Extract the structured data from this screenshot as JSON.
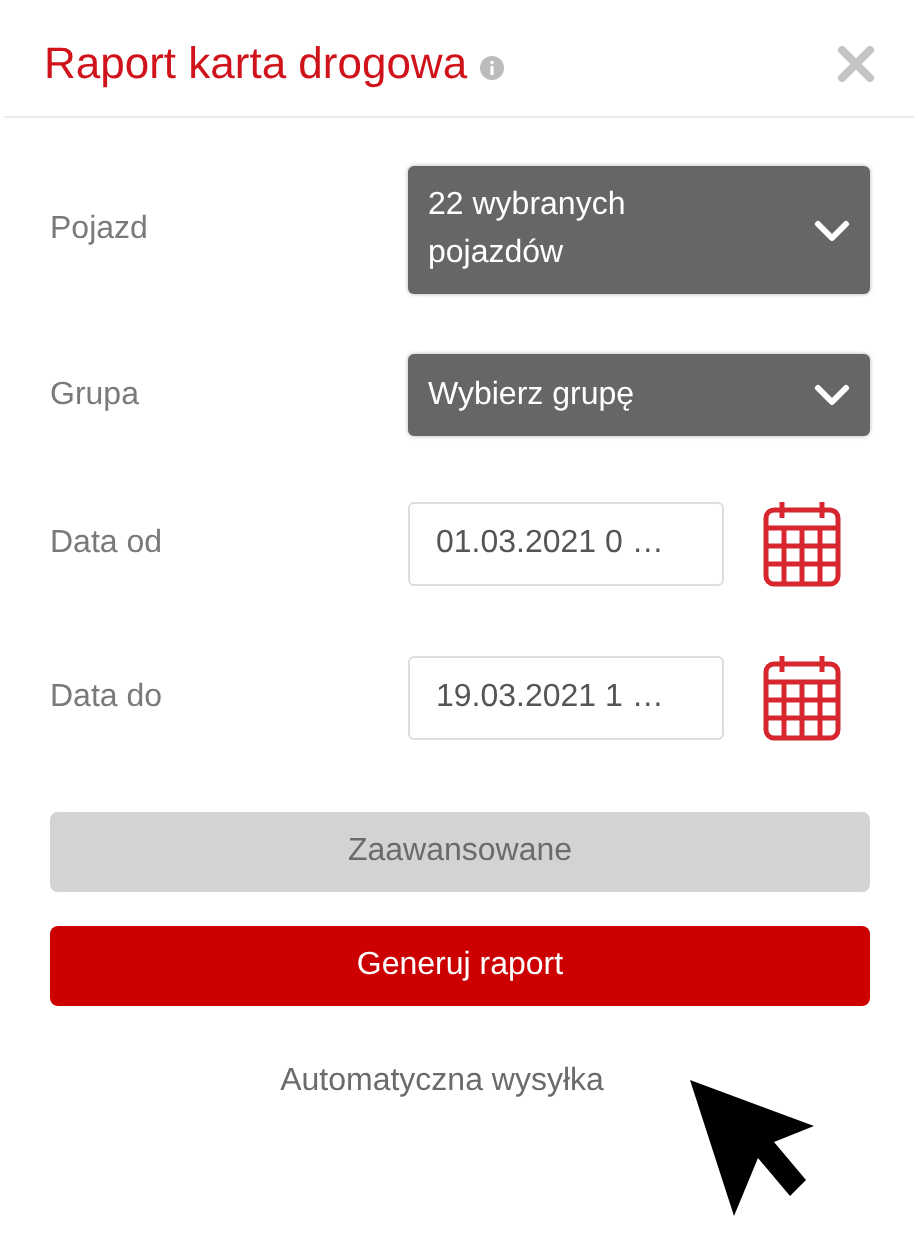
{
  "dialog": {
    "title": "Raport karta drogowa"
  },
  "fields": [
    {
      "kind": "select",
      "label": "Pojazd",
      "value": "22 wybranych pojazdów"
    },
    {
      "kind": "select",
      "label": "Grupa",
      "value": "Wybierz grupę"
    },
    {
      "kind": "date",
      "label": "Data od",
      "value": "01.03.2021 0 …"
    },
    {
      "kind": "date",
      "label": "Data do",
      "value": "19.03.2021 1 …"
    }
  ],
  "buttons": [
    {
      "kind": "secondary",
      "label": "Zaawansowane"
    },
    {
      "kind": "primary",
      "label": "Generuj raport"
    }
  ],
  "link": "Automatyczna wysyłka"
}
